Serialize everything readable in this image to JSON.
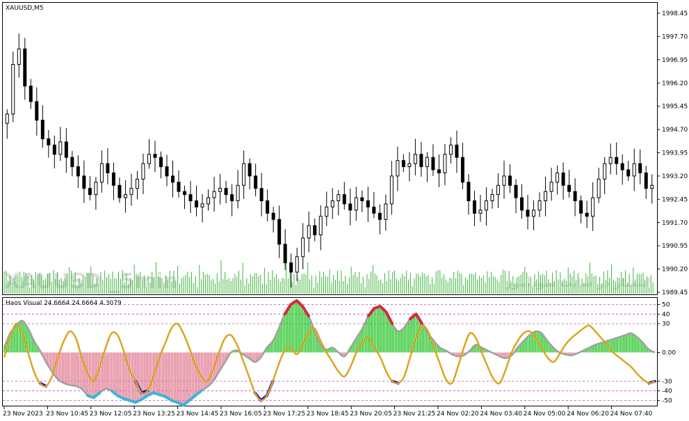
{
  "main_panel": {
    "symbol_label": "XAUUSD,M5",
    "watermark_left": "XAUUSD _5min",
    "watermark_right": "انتشار در سایت سودآموز",
    "price_ticks": [
      "1998.45",
      "1997.70",
      "1996.95",
      "1996.20",
      "1995.45",
      "1994.70",
      "1993.95",
      "1993.20",
      "1992.45",
      "1991.70",
      "1990.95",
      "1990.20",
      "1989.45"
    ]
  },
  "indicator_panel": {
    "label": "Haos Visual 24.6664 24.6664 4.3079",
    "level_ticks": [
      "50",
      "40",
      "30",
      "0.00",
      "-30",
      "-40",
      "-50"
    ]
  },
  "time_axis": {
    "labels": [
      "23 Nov 2023",
      "23 Nov 10:45",
      "23 Nov 12:05",
      "23 Nov 13:25",
      "23 Nov 14:45",
      "23 Nov 16:05",
      "23 Nov 17:25",
      "23 Nov 18:45",
      "23 Nov 20:05",
      "23 Nov 21:25",
      "24 Nov 02:20",
      "24 Nov 03:40",
      "24 Nov 05:00",
      "24 Nov 06:20",
      "24 Nov 07:40"
    ]
  },
  "colors": {
    "candle": "#000000",
    "volume": "#3cb43c",
    "hist_positive": "#22c322",
    "hist_negative": "#e07890",
    "signal_line": "#daa520",
    "main_line": "#a0a0a0",
    "overbought": "#d42a3a",
    "oversold_deep": "#3ab4dc",
    "oversold": "#1a1ad0",
    "level_line": "#c040c0"
  },
  "chart_data": [
    {
      "type": "candlestick",
      "series_name": "XAUUSD,M5",
      "ylim": [
        1989.45,
        1998.45
      ],
      "close": [
        1995.2,
        1996.8,
        1997.3,
        1996.1,
        1995.6,
        1995.0,
        1994.4,
        1994.2,
        1993.9,
        1994.3,
        1993.8,
        1993.5,
        1993.2,
        1992.8,
        1992.6,
        1993.0,
        1993.6,
        1993.3,
        1992.9,
        1992.5,
        1992.6,
        1992.8,
        1993.1,
        1993.6,
        1993.9,
        1993.8,
        1993.5,
        1993.2,
        1993.0,
        1992.7,
        1992.6,
        1992.4,
        1992.2,
        1992.3,
        1992.5,
        1992.7,
        1992.8,
        1992.6,
        1992.4,
        1992.9,
        1993.6,
        1993.2,
        1992.8,
        1992.4,
        1992.0,
        1991.8,
        1991.0,
        1990.4,
        1990.1,
        1990.6,
        1991.2,
        1991.6,
        1991.3,
        1991.9,
        1992.2,
        1992.4,
        1992.6,
        1992.3,
        1992.1,
        1992.5,
        1992.4,
        1992.2,
        1992.0,
        1991.8,
        1992.3,
        1993.2,
        1993.7,
        1993.5,
        1993.6,
        1993.9,
        1993.5,
        1993.8,
        1993.4,
        1993.3,
        1993.9,
        1994.2,
        1993.8,
        1993.0,
        1992.4,
        1992.0,
        1992.1,
        1992.4,
        1992.6,
        1992.9,
        1993.2,
        1992.9,
        1992.5,
        1992.1,
        1991.9,
        1992.1,
        1992.4,
        1992.7,
        1993.0,
        1993.3,
        1992.9,
        1992.7,
        1992.4,
        1992.0,
        1991.9,
        1992.5,
        1993.1,
        1993.6,
        1993.8,
        1993.6,
        1993.4,
        1993.2,
        1993.6,
        1993.3,
        1992.8,
        1992.9
      ]
    },
    {
      "type": "oscillator",
      "series_name": "Haos Visual",
      "ylim": [
        -54,
        54
      ],
      "levels": [
        50,
        40,
        30,
        0,
        -30,
        -40,
        -50
      ],
      "main": [
        5,
        20,
        28,
        33,
        25,
        12,
        2,
        -10,
        -20,
        -28,
        -32,
        -34,
        -35,
        -38,
        -45,
        -47,
        -42,
        -38,
        -40,
        -45,
        -48,
        -50,
        -52,
        -49,
        -45,
        -42,
        -44,
        -46,
        -50,
        -52,
        -55,
        -50,
        -45,
        -40,
        -36,
        -30,
        -20,
        -10,
        0,
        2,
        -2,
        -6,
        -10,
        -5,
        5,
        12,
        25,
        40,
        50,
        54,
        48,
        38,
        22,
        8,
        3,
        5,
        0,
        -4,
        5,
        15,
        25,
        38,
        46,
        48,
        42,
        30,
        22,
        26,
        35,
        40,
        30,
        20,
        12,
        5,
        2,
        -2,
        -4,
        -3,
        2,
        8,
        5,
        2,
        -1,
        -4,
        -6,
        -3,
        5,
        12,
        18,
        22,
        20,
        12,
        5,
        0,
        -2,
        -3,
        -1,
        2,
        5,
        8,
        10,
        12,
        14,
        16,
        18,
        20,
        16,
        10,
        3,
        0
      ],
      "signal": [
        -5,
        15,
        30,
        20,
        0,
        -20,
        -32,
        -35,
        -25,
        -5,
        12,
        22,
        15,
        -5,
        -22,
        -30,
        -15,
        5,
        20,
        18,
        2,
        -18,
        -30,
        -42,
        -40,
        -25,
        -5,
        10,
        25,
        30,
        20,
        5,
        -12,
        -25,
        -30,
        -18,
        0,
        15,
        18,
        8,
        -8,
        -25,
        -42,
        -50,
        -45,
        -30,
        -12,
        2,
        5,
        -2,
        8,
        20,
        25,
        12,
        0,
        -10,
        -20,
        -25,
        -15,
        0,
        10,
        15,
        5,
        -5,
        -20,
        -30,
        -32,
        -25,
        -5,
        15,
        28,
        22,
        5,
        -12,
        -28,
        -32,
        -15,
        5,
        20,
        15,
        0,
        -15,
        -28,
        -32,
        -18,
        0,
        12,
        20,
        22,
        15,
        5,
        -5,
        -10,
        -2,
        8,
        15,
        20,
        25,
        28,
        22,
        15,
        8,
        0,
        -5,
        -10,
        -15,
        -22,
        -28,
        -32,
        -30
      ]
    }
  ]
}
